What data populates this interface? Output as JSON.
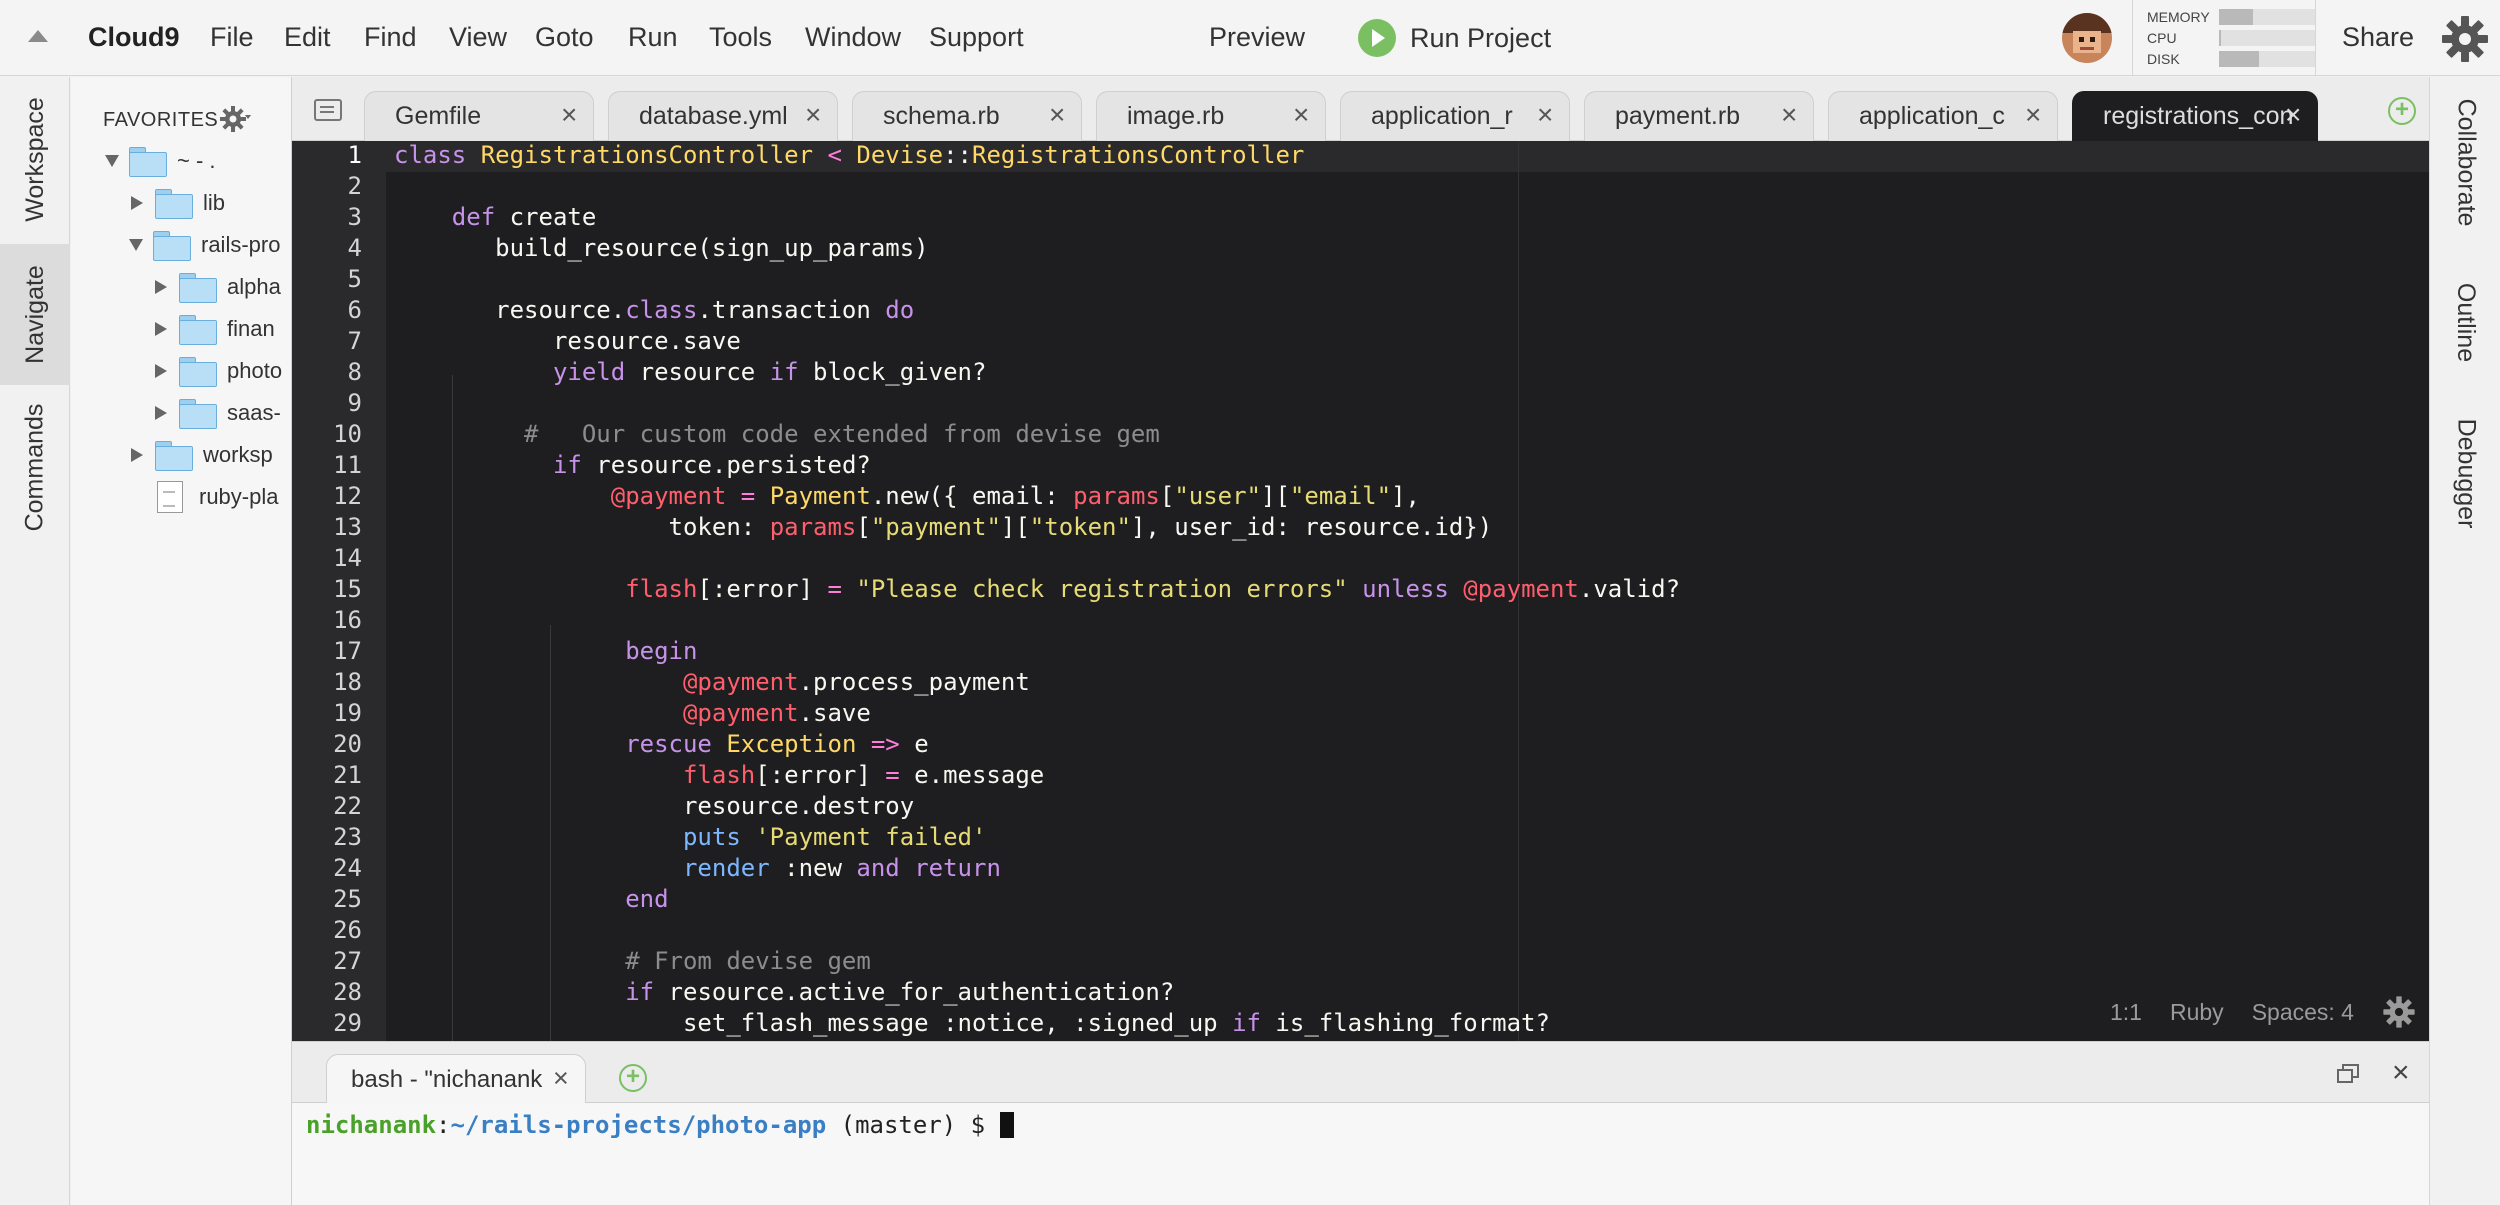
{
  "menubar": {
    "brand": "Cloud9",
    "items": [
      "File",
      "Edit",
      "Find",
      "View",
      "Goto",
      "Run",
      "Tools",
      "Window",
      "Support"
    ],
    "preview": "Preview",
    "run_project": "Run Project",
    "meters": [
      {
        "label": "MEMORY",
        "value": 0.35
      },
      {
        "label": "CPU",
        "value": 0.02
      },
      {
        "label": "DISK",
        "value": 0.42
      }
    ],
    "share": "Share"
  },
  "left_tabs": [
    "Workspace",
    "Navigate",
    "Commands"
  ],
  "right_tabs": [
    "Collaborate",
    "Outline",
    "Debugger"
  ],
  "tree": {
    "favorites": "FAVORITES",
    "nodes": [
      {
        "label": "~ - ."
      },
      {
        "label": "lib"
      },
      {
        "label": "rails-pro"
      },
      {
        "label": "alpha"
      },
      {
        "label": "finan"
      },
      {
        "label": "photo"
      },
      {
        "label": "saas-"
      },
      {
        "label": "worksp"
      },
      {
        "label": "ruby-pla"
      }
    ]
  },
  "editor_tabs": [
    {
      "label": "Gemfile"
    },
    {
      "label": "database.yml"
    },
    {
      "label": "schema.rb"
    },
    {
      "label": "image.rb"
    },
    {
      "label": "application_r"
    },
    {
      "label": "payment.rb"
    },
    {
      "label": "application_c"
    },
    {
      "label": "registrations_con"
    }
  ],
  "code": {
    "lines": [
      "class RegistrationsController < Devise::RegistrationsController",
      "",
      "    def create",
      "       build_resource(sign_up_params)",
      "",
      "       resource.class.transaction do",
      "           resource.save",
      "           yield resource if block_given?",
      "",
      "         #   Our custom code extended from devise gem",
      "           if resource.persisted?",
      "               @payment = Payment.new({ email: params[\"user\"][\"email\"],",
      "                   token: params[\"payment\"][\"token\"], user_id: resource.id})",
      "",
      "                flash[:error] = \"Please check registration errors\" unless @payment.valid?",
      "",
      "                begin",
      "                    @payment.process_payment",
      "                    @payment.save",
      "                rescue Exception => e",
      "                    flash[:error] = e.message",
      "                    resource.destroy",
      "                    puts 'Payment failed'",
      "                    render :new and return",
      "                end",
      "",
      "                # From devise gem",
      "                if resource.active_for_authentication?",
      "                    set_flash_message :notice, :signed_up if is_flashing_format?"
    ]
  },
  "status": {
    "position": "1:1",
    "language": "Ruby",
    "spaces": "Spaces: 4"
  },
  "terminal": {
    "tab_label": "bash - \"nichanank",
    "user": "nichanank",
    "path": "~/rails-projects/photo-app",
    "branch": " (master) $ "
  },
  "icons": {
    "close": "×",
    "add": "+"
  },
  "colors": {
    "accent_green": "#7bbf63",
    "editor_bg": "#1e1e20"
  }
}
